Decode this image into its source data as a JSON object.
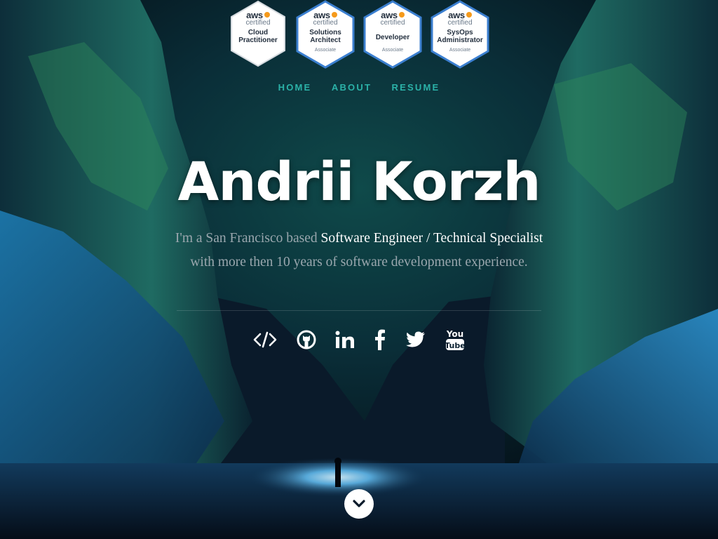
{
  "badges": [
    {
      "aws": "aws",
      "cert": "certified",
      "name": "Cloud Practitioner",
      "level": ""
    },
    {
      "aws": "aws",
      "cert": "certified",
      "name": "Solutions Architect",
      "level": "Associate"
    },
    {
      "aws": "aws",
      "cert": "certified",
      "name": "Developer",
      "level": "Associate"
    },
    {
      "aws": "aws",
      "cert": "certified",
      "name": "SysOps Administrator",
      "level": "Associate"
    }
  ],
  "nav": {
    "home": "HOME",
    "about": "ABOUT",
    "resume": "RESUME"
  },
  "hero": {
    "name": "Andrii Korzh",
    "intro_prefix": "I'm a San Francisco based ",
    "intro_role": "Software Engineer / Technical Specialist",
    "intro_suffix": " with more then 10 years of software development experience."
  },
  "social": [
    "code-icon",
    "github-icon",
    "linkedin-icon",
    "facebook-icon",
    "twitter-icon",
    "youtube-icon"
  ],
  "youtube_glyph": {
    "top": "You",
    "bottom": "Tube"
  },
  "colors": {
    "nav": "#2bb2a8",
    "badge_border": "#3b7fd0",
    "aws_dot": "#f59a1b"
  }
}
